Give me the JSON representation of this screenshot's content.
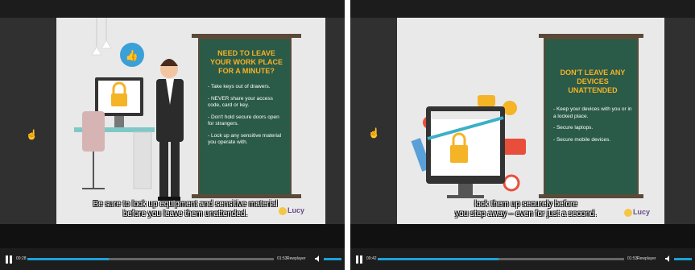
{
  "left_video": {
    "board_title": "NEED TO LEAVE YOUR WORK PLACE FOR A MINUTE?",
    "bullets": [
      "- Take keys out of drawers.",
      "- NEVER share your access code, card or key.",
      "- Don't hold secure doors open for strangers.",
      "- Lock up any sensitive material you operate with."
    ],
    "caption_line1": "Be sure to lock up equipment and sensitive material",
    "caption_line2": "before you leave them unattended.",
    "brand": "Lucy",
    "time_current": "00:28",
    "time_total": "01:53",
    "rewind_label": "Rewplayer",
    "progress_fraction": 0.33
  },
  "right_video": {
    "board_title": "DON'T LEAVE ANY DEVICES UNATTENDED",
    "bullets": [
      "- Keep your devices with you or in a locked place.",
      "- Secure laptops.",
      "- Secure mobile devices."
    ],
    "caption_line1": "lock them up securely before",
    "caption_line2": "you step away – even for just a second.",
    "brand": "Lucy",
    "time_current": "00:42",
    "time_total": "01:53",
    "rewind_label": "Rewplayer",
    "progress_fraction": 0.49
  },
  "colors": {
    "board": "#2a5a48",
    "board_title": "#f5b326",
    "progress": "#1da1d8"
  }
}
